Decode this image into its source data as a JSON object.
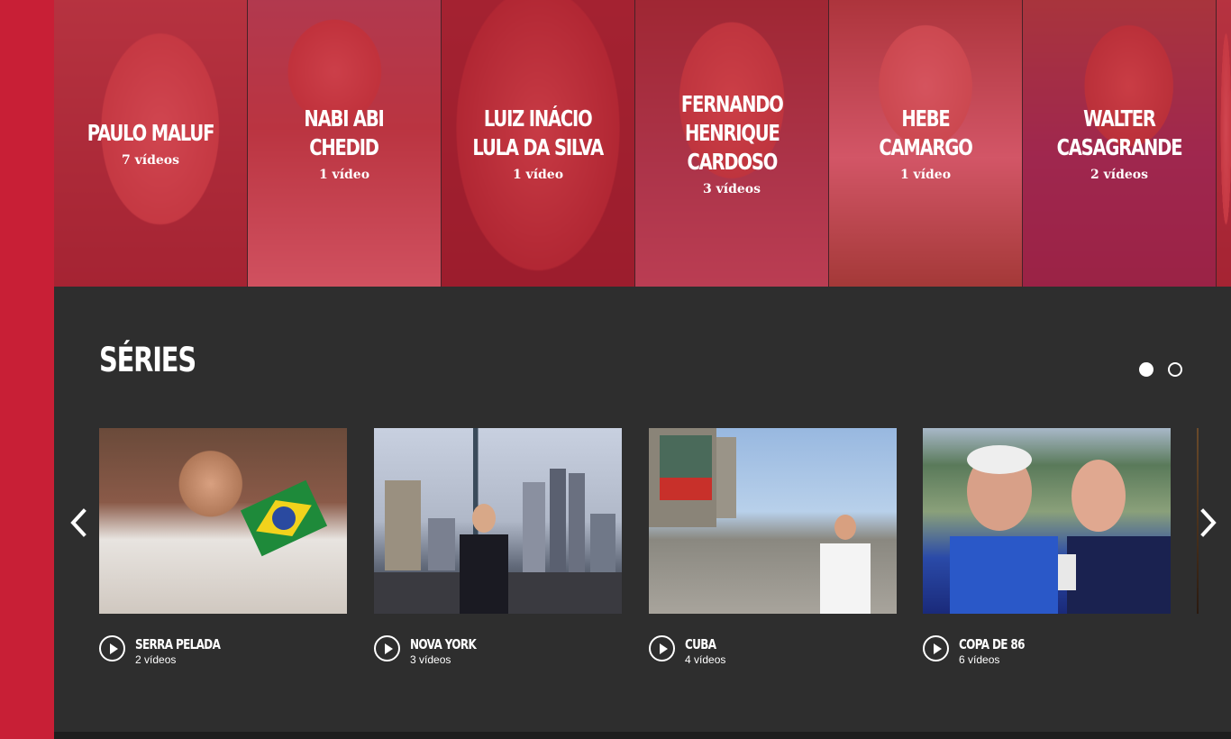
{
  "people": [
    {
      "name": "PAULO MALUF",
      "count": "7 vídeos"
    },
    {
      "name": "NABI ABI\nCHEDID",
      "count": "1 vídeo"
    },
    {
      "name": "LUIZ INÁCIO\nLULA DA SILVA",
      "count": "1 vídeo"
    },
    {
      "name": "FERNANDO\nHENRIQUE\nCARDOSO",
      "count": "3 vídeos"
    },
    {
      "name": "HEBE CAMARGO",
      "count": "1 vídeo"
    },
    {
      "name": "WALTER\nCASAGRANDE",
      "count": "2 vídeos"
    }
  ],
  "series": {
    "title": "SÉRIES",
    "pagination_pages": 2,
    "active_page": 1,
    "items": [
      {
        "title": "SERRA PELADA",
        "count": "2 vídeos"
      },
      {
        "title": "NOVA YORK",
        "count": "3 vídeos"
      },
      {
        "title": "CUBA",
        "count": "4 vídeos"
      },
      {
        "title": "COPA DE 86",
        "count": "6 vídeos"
      }
    ]
  },
  "colors": {
    "brand_red": "#c81f36",
    "section_bg": "#2e2e2e"
  },
  "icons": {
    "prev": "chevron-left-icon",
    "next": "chevron-right-icon",
    "play": "play-circle-icon"
  }
}
